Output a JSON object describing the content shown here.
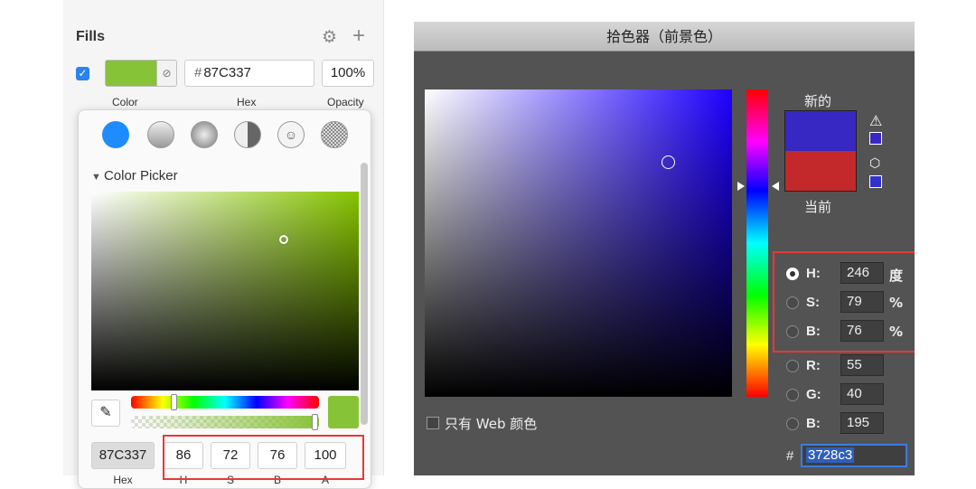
{
  "sketch": {
    "section_title": "Fills",
    "fill": {
      "checked": true,
      "swatch_color": "#87C337",
      "hex_prefix": "#",
      "hex_value": "87C337",
      "opacity_value": "100%",
      "labels": {
        "color": "Color",
        "hex": "Hex",
        "opacity": "Opacity"
      }
    },
    "picker": {
      "title": "Color Picker",
      "fill_types": [
        "solid-fill",
        "linear-gradient",
        "radial-gradient",
        "angular-gradient",
        "pattern-fill",
        "noise-fill"
      ],
      "hue_position": 0.23,
      "alpha_position": 1.0,
      "values": {
        "hex": "87C337",
        "h": "86",
        "s": "72",
        "b": "76",
        "a": "100"
      },
      "value_labels": {
        "hex": "Hex",
        "h": "H",
        "s": "S",
        "b": "B",
        "a": "A"
      }
    }
  },
  "photoshop": {
    "dialog_title": "拾色器（前景色）",
    "new_label": "新的",
    "current_label": "当前",
    "new_color": "#3728C3",
    "current_color": "#C3282B",
    "fields": {
      "h": {
        "label": "H:",
        "value": "246",
        "unit": "度",
        "selected": true
      },
      "s": {
        "label": "S:",
        "value": "79",
        "unit": "%",
        "selected": false
      },
      "b": {
        "label": "B:",
        "value": "76",
        "unit": "%",
        "selected": false
      },
      "r": {
        "label": "R:",
        "value": "55",
        "selected": false
      },
      "g": {
        "label": "G:",
        "value": "40",
        "selected": false
      },
      "b2": {
        "label": "B:",
        "value": "195",
        "selected": false
      }
    },
    "web_only_label": "只有 Web 颜色",
    "hex_prefix": "#",
    "hex_value": "3728c3"
  },
  "colors": {
    "accent_blue": "#2A82EF",
    "highlight_red": "#E53935",
    "sketch_green": "#87C337",
    "ps_blue": "#3728C3",
    "ps_red": "#C3282B"
  }
}
